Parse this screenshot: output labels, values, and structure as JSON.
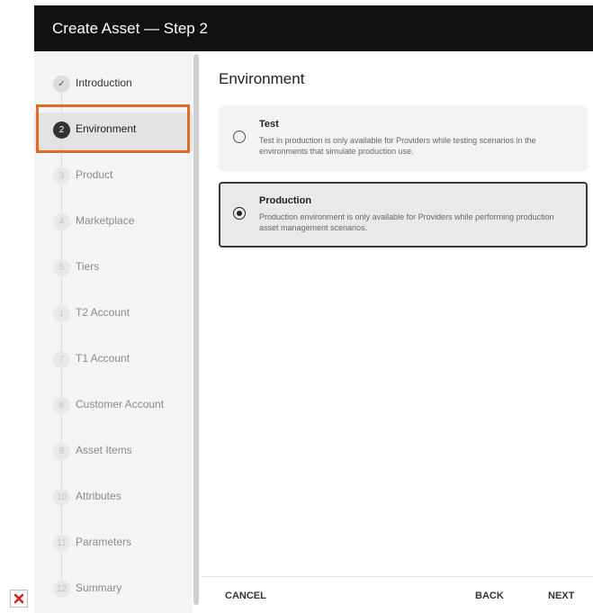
{
  "window": {
    "title": "Create Asset — Step 2"
  },
  "steps": [
    {
      "number": "✓",
      "label": "Introduction",
      "state": "done"
    },
    {
      "number": "2",
      "label": "Environment",
      "state": "active"
    },
    {
      "number": "3",
      "label": "Product",
      "state": "pending"
    },
    {
      "number": "4",
      "label": "Marketplace",
      "state": "pending"
    },
    {
      "number": "5",
      "label": "Tiers",
      "state": "pending"
    },
    {
      "number": "↓",
      "label": "T2 Account",
      "state": "ready"
    },
    {
      "number": "7",
      "label": "T1 Account",
      "state": "pending"
    },
    {
      "number": "8",
      "label": "Customer Account",
      "state": "pending"
    },
    {
      "number": "9",
      "label": "Asset Items",
      "state": "pending"
    },
    {
      "number": "10",
      "label": "Attributes",
      "state": "pending"
    },
    {
      "number": "11",
      "label": "Parameters",
      "state": "pending"
    },
    {
      "number": "12",
      "label": "Summary",
      "state": "pending"
    }
  ],
  "main": {
    "title": "Environment",
    "options": [
      {
        "title": "Test",
        "description": "Test in production is only available for Providers while testing scenarios in the environments that simulate production use.",
        "selected": false
      },
      {
        "title": "Production",
        "description": "Production environment is only available for Providers while performing production asset management scenarios.",
        "selected": true
      }
    ]
  },
  "footer": {
    "cancel": "CANCEL",
    "back": "BACK",
    "next": "NEXT"
  },
  "colors": {
    "highlight": "#e06b21",
    "titlebar": "#111111",
    "sidebar": "#f4f4f4"
  },
  "icons": {
    "broken_image": "broken-image-icon",
    "check": "check-icon"
  }
}
